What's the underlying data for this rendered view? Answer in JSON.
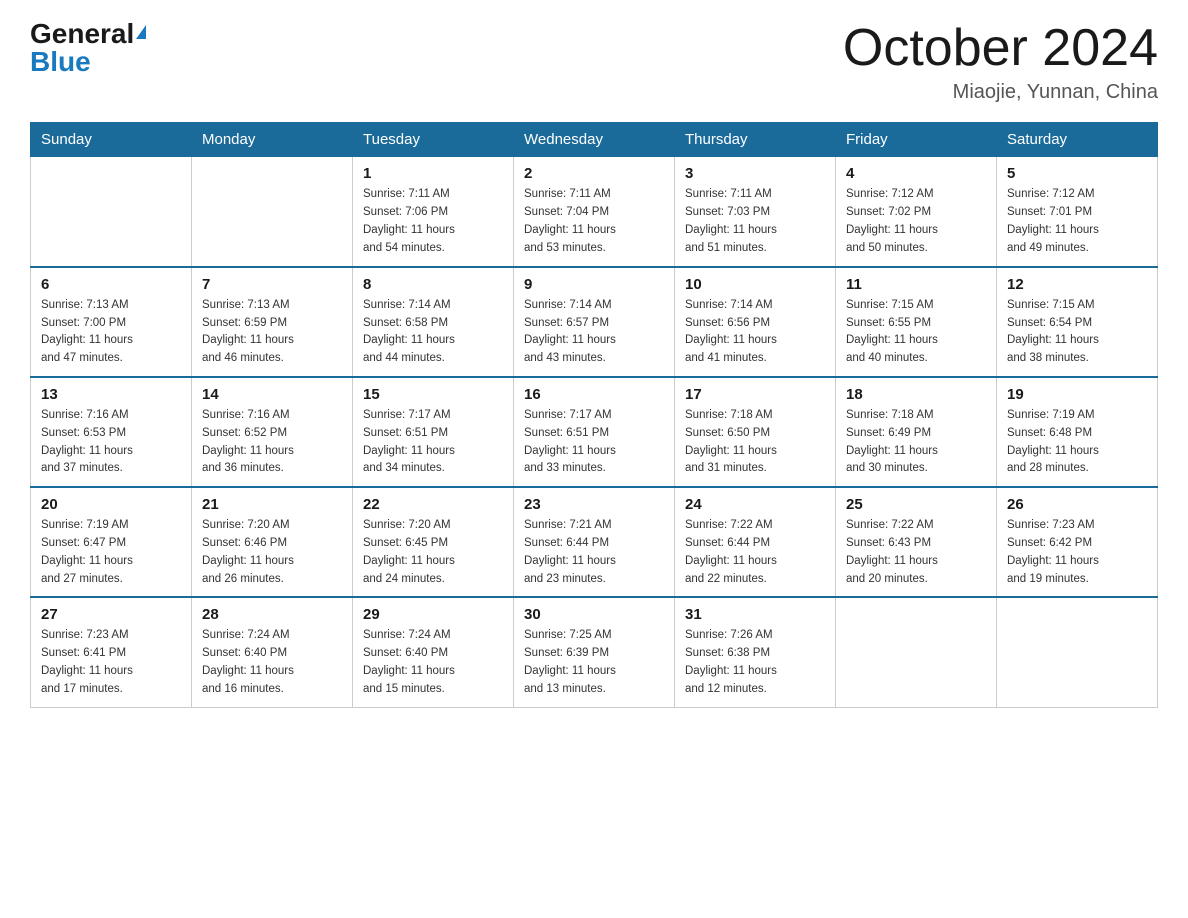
{
  "logo": {
    "general": "General",
    "blue": "Blue"
  },
  "title": "October 2024",
  "location": "Miaojie, Yunnan, China",
  "days_of_week": [
    "Sunday",
    "Monday",
    "Tuesday",
    "Wednesday",
    "Thursday",
    "Friday",
    "Saturday"
  ],
  "weeks": [
    [
      {
        "day": "",
        "info": ""
      },
      {
        "day": "",
        "info": ""
      },
      {
        "day": "1",
        "info": "Sunrise: 7:11 AM\nSunset: 7:06 PM\nDaylight: 11 hours\nand 54 minutes."
      },
      {
        "day": "2",
        "info": "Sunrise: 7:11 AM\nSunset: 7:04 PM\nDaylight: 11 hours\nand 53 minutes."
      },
      {
        "day": "3",
        "info": "Sunrise: 7:11 AM\nSunset: 7:03 PM\nDaylight: 11 hours\nand 51 minutes."
      },
      {
        "day": "4",
        "info": "Sunrise: 7:12 AM\nSunset: 7:02 PM\nDaylight: 11 hours\nand 50 minutes."
      },
      {
        "day": "5",
        "info": "Sunrise: 7:12 AM\nSunset: 7:01 PM\nDaylight: 11 hours\nand 49 minutes."
      }
    ],
    [
      {
        "day": "6",
        "info": "Sunrise: 7:13 AM\nSunset: 7:00 PM\nDaylight: 11 hours\nand 47 minutes."
      },
      {
        "day": "7",
        "info": "Sunrise: 7:13 AM\nSunset: 6:59 PM\nDaylight: 11 hours\nand 46 minutes."
      },
      {
        "day": "8",
        "info": "Sunrise: 7:14 AM\nSunset: 6:58 PM\nDaylight: 11 hours\nand 44 minutes."
      },
      {
        "day": "9",
        "info": "Sunrise: 7:14 AM\nSunset: 6:57 PM\nDaylight: 11 hours\nand 43 minutes."
      },
      {
        "day": "10",
        "info": "Sunrise: 7:14 AM\nSunset: 6:56 PM\nDaylight: 11 hours\nand 41 minutes."
      },
      {
        "day": "11",
        "info": "Sunrise: 7:15 AM\nSunset: 6:55 PM\nDaylight: 11 hours\nand 40 minutes."
      },
      {
        "day": "12",
        "info": "Sunrise: 7:15 AM\nSunset: 6:54 PM\nDaylight: 11 hours\nand 38 minutes."
      }
    ],
    [
      {
        "day": "13",
        "info": "Sunrise: 7:16 AM\nSunset: 6:53 PM\nDaylight: 11 hours\nand 37 minutes."
      },
      {
        "day": "14",
        "info": "Sunrise: 7:16 AM\nSunset: 6:52 PM\nDaylight: 11 hours\nand 36 minutes."
      },
      {
        "day": "15",
        "info": "Sunrise: 7:17 AM\nSunset: 6:51 PM\nDaylight: 11 hours\nand 34 minutes."
      },
      {
        "day": "16",
        "info": "Sunrise: 7:17 AM\nSunset: 6:51 PM\nDaylight: 11 hours\nand 33 minutes."
      },
      {
        "day": "17",
        "info": "Sunrise: 7:18 AM\nSunset: 6:50 PM\nDaylight: 11 hours\nand 31 minutes."
      },
      {
        "day": "18",
        "info": "Sunrise: 7:18 AM\nSunset: 6:49 PM\nDaylight: 11 hours\nand 30 minutes."
      },
      {
        "day": "19",
        "info": "Sunrise: 7:19 AM\nSunset: 6:48 PM\nDaylight: 11 hours\nand 28 minutes."
      }
    ],
    [
      {
        "day": "20",
        "info": "Sunrise: 7:19 AM\nSunset: 6:47 PM\nDaylight: 11 hours\nand 27 minutes."
      },
      {
        "day": "21",
        "info": "Sunrise: 7:20 AM\nSunset: 6:46 PM\nDaylight: 11 hours\nand 26 minutes."
      },
      {
        "day": "22",
        "info": "Sunrise: 7:20 AM\nSunset: 6:45 PM\nDaylight: 11 hours\nand 24 minutes."
      },
      {
        "day": "23",
        "info": "Sunrise: 7:21 AM\nSunset: 6:44 PM\nDaylight: 11 hours\nand 23 minutes."
      },
      {
        "day": "24",
        "info": "Sunrise: 7:22 AM\nSunset: 6:44 PM\nDaylight: 11 hours\nand 22 minutes."
      },
      {
        "day": "25",
        "info": "Sunrise: 7:22 AM\nSunset: 6:43 PM\nDaylight: 11 hours\nand 20 minutes."
      },
      {
        "day": "26",
        "info": "Sunrise: 7:23 AM\nSunset: 6:42 PM\nDaylight: 11 hours\nand 19 minutes."
      }
    ],
    [
      {
        "day": "27",
        "info": "Sunrise: 7:23 AM\nSunset: 6:41 PM\nDaylight: 11 hours\nand 17 minutes."
      },
      {
        "day": "28",
        "info": "Sunrise: 7:24 AM\nSunset: 6:40 PM\nDaylight: 11 hours\nand 16 minutes."
      },
      {
        "day": "29",
        "info": "Sunrise: 7:24 AM\nSunset: 6:40 PM\nDaylight: 11 hours\nand 15 minutes."
      },
      {
        "day": "30",
        "info": "Sunrise: 7:25 AM\nSunset: 6:39 PM\nDaylight: 11 hours\nand 13 minutes."
      },
      {
        "day": "31",
        "info": "Sunrise: 7:26 AM\nSunset: 6:38 PM\nDaylight: 11 hours\nand 12 minutes."
      },
      {
        "day": "",
        "info": ""
      },
      {
        "day": "",
        "info": ""
      }
    ]
  ]
}
